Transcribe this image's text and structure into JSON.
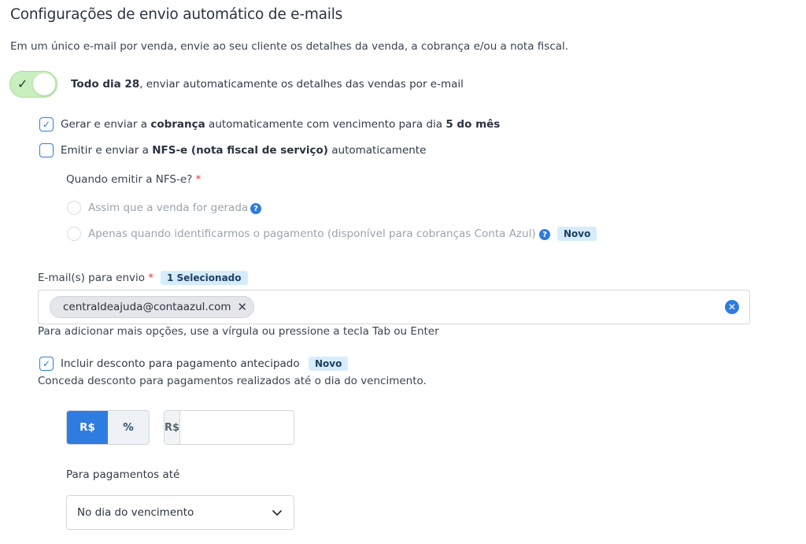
{
  "header": {
    "title": "Configurações de envio automático de e-mails",
    "subtitle": "Em um único e-mail por venda, envie ao seu cliente os detalhes da venda, a cobrança e/ou a nota fiscal."
  },
  "auto_send": {
    "enabled": true,
    "bold": "Todo dia 28",
    "rest": ", enviar automaticamente os detalhes das vendas por e-mail"
  },
  "charge_option": {
    "checked": true,
    "part1": "Gerar e enviar a ",
    "bold1": "cobrança",
    "part2": " automaticamente com vencimento para dia ",
    "bold2": "5 do mês"
  },
  "nfse_option": {
    "checked": false,
    "part1": "Emitir e enviar a ",
    "bold1": "NFS-e (nota fiscal de serviço)",
    "part2": " automaticamente"
  },
  "nfse_when": {
    "question": "Quando emitir a NFS-e?",
    "required_mark": "*",
    "options": [
      {
        "label": "Assim que a venda for gerada"
      },
      {
        "label": "Apenas quando identificarmos o pagamento (disponível para cobranças Conta Azul)",
        "badge": "Novo"
      }
    ]
  },
  "emails": {
    "label": "E-mail(s) para envio",
    "required_mark": "*",
    "selected_badge": "1 Selecionado",
    "chips": [
      "centraldeajuda@contaazul.com"
    ],
    "hint": "Para adicionar mais opções, use a vírgula ou pressione a tecla Tab ou Enter"
  },
  "discount": {
    "checked": true,
    "label": "Incluir desconto para pagamento antecipado",
    "badge": "Novo",
    "description": "Conceda desconto para pagamentos realizados até o dia do vencimento.",
    "type_options": [
      "R$",
      "%"
    ],
    "selected_type": "R$",
    "amount_prefix": "R$",
    "amount_value": ""
  },
  "payment_until": {
    "label": "Para pagamentos até",
    "selected": "No dia do vencimento"
  },
  "colors": {
    "accent": "#2f7ce0",
    "toggle_on": "#c8efbd",
    "badge_bg": "#d6ecfb",
    "required": "#d43a3a"
  },
  "icons": {
    "toggle_check": "check-icon",
    "help": "help-circle-icon",
    "chip_remove": "close-icon",
    "clear_all": "clear-circle-icon",
    "dropdown": "chevron-down-icon"
  }
}
